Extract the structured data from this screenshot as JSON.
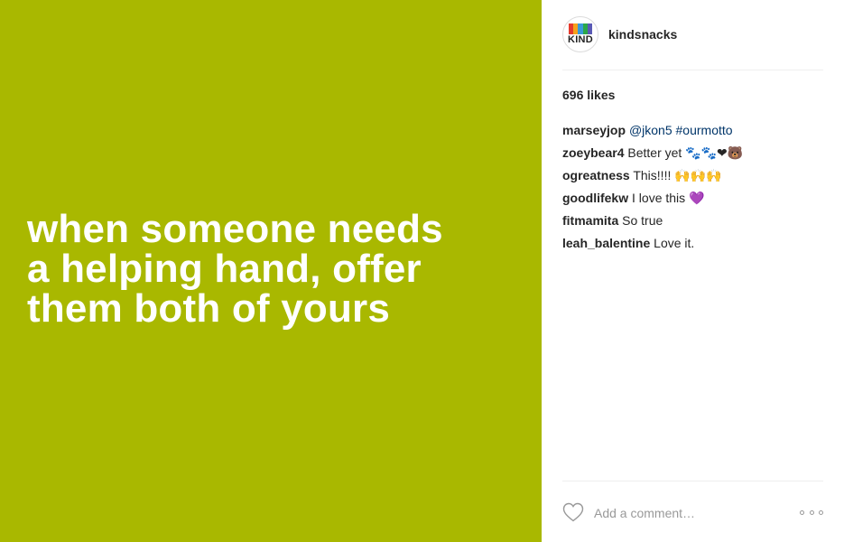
{
  "post": {
    "quote": "when someone needs\na helping hand, offer\nthem both of yours",
    "background_color": "#a9b800"
  },
  "profile": {
    "logo_text": "KIND",
    "logo_colors": [
      "#e63b2e",
      "#f7a21b",
      "#3a9ad9",
      "#2ba84a",
      "#5a5ab5"
    ],
    "username": "kindsnacks"
  },
  "likes": "696 likes",
  "comments": [
    {
      "author": "marseyjop",
      "text": "@jkon5 #ourmotto",
      "text_style": "mention",
      "emoji": ""
    },
    {
      "author": "zoeybear4",
      "text": "Better yet",
      "text_style": "plain",
      "emoji": "🐾🐾❤🐻"
    },
    {
      "author": "ogreatness",
      "text": "This!!!!",
      "text_style": "plain",
      "emoji": "🙌🙌🙌"
    },
    {
      "author": "goodlifekw",
      "text": "I love this",
      "text_style": "plain",
      "emoji": "💜"
    },
    {
      "author": "fitmamita",
      "text": "So true",
      "text_style": "plain",
      "emoji": ""
    },
    {
      "author": "leah_balentine",
      "text": "Love it.",
      "text_style": "plain",
      "emoji": ""
    }
  ],
  "footer": {
    "comment_placeholder": "Add a comment…",
    "heart_icon": "heart-outline-icon",
    "more_icon": "more-options-icon"
  },
  "colors": {
    "mention": "#003569",
    "text": "#262626",
    "muted": "#999999"
  }
}
